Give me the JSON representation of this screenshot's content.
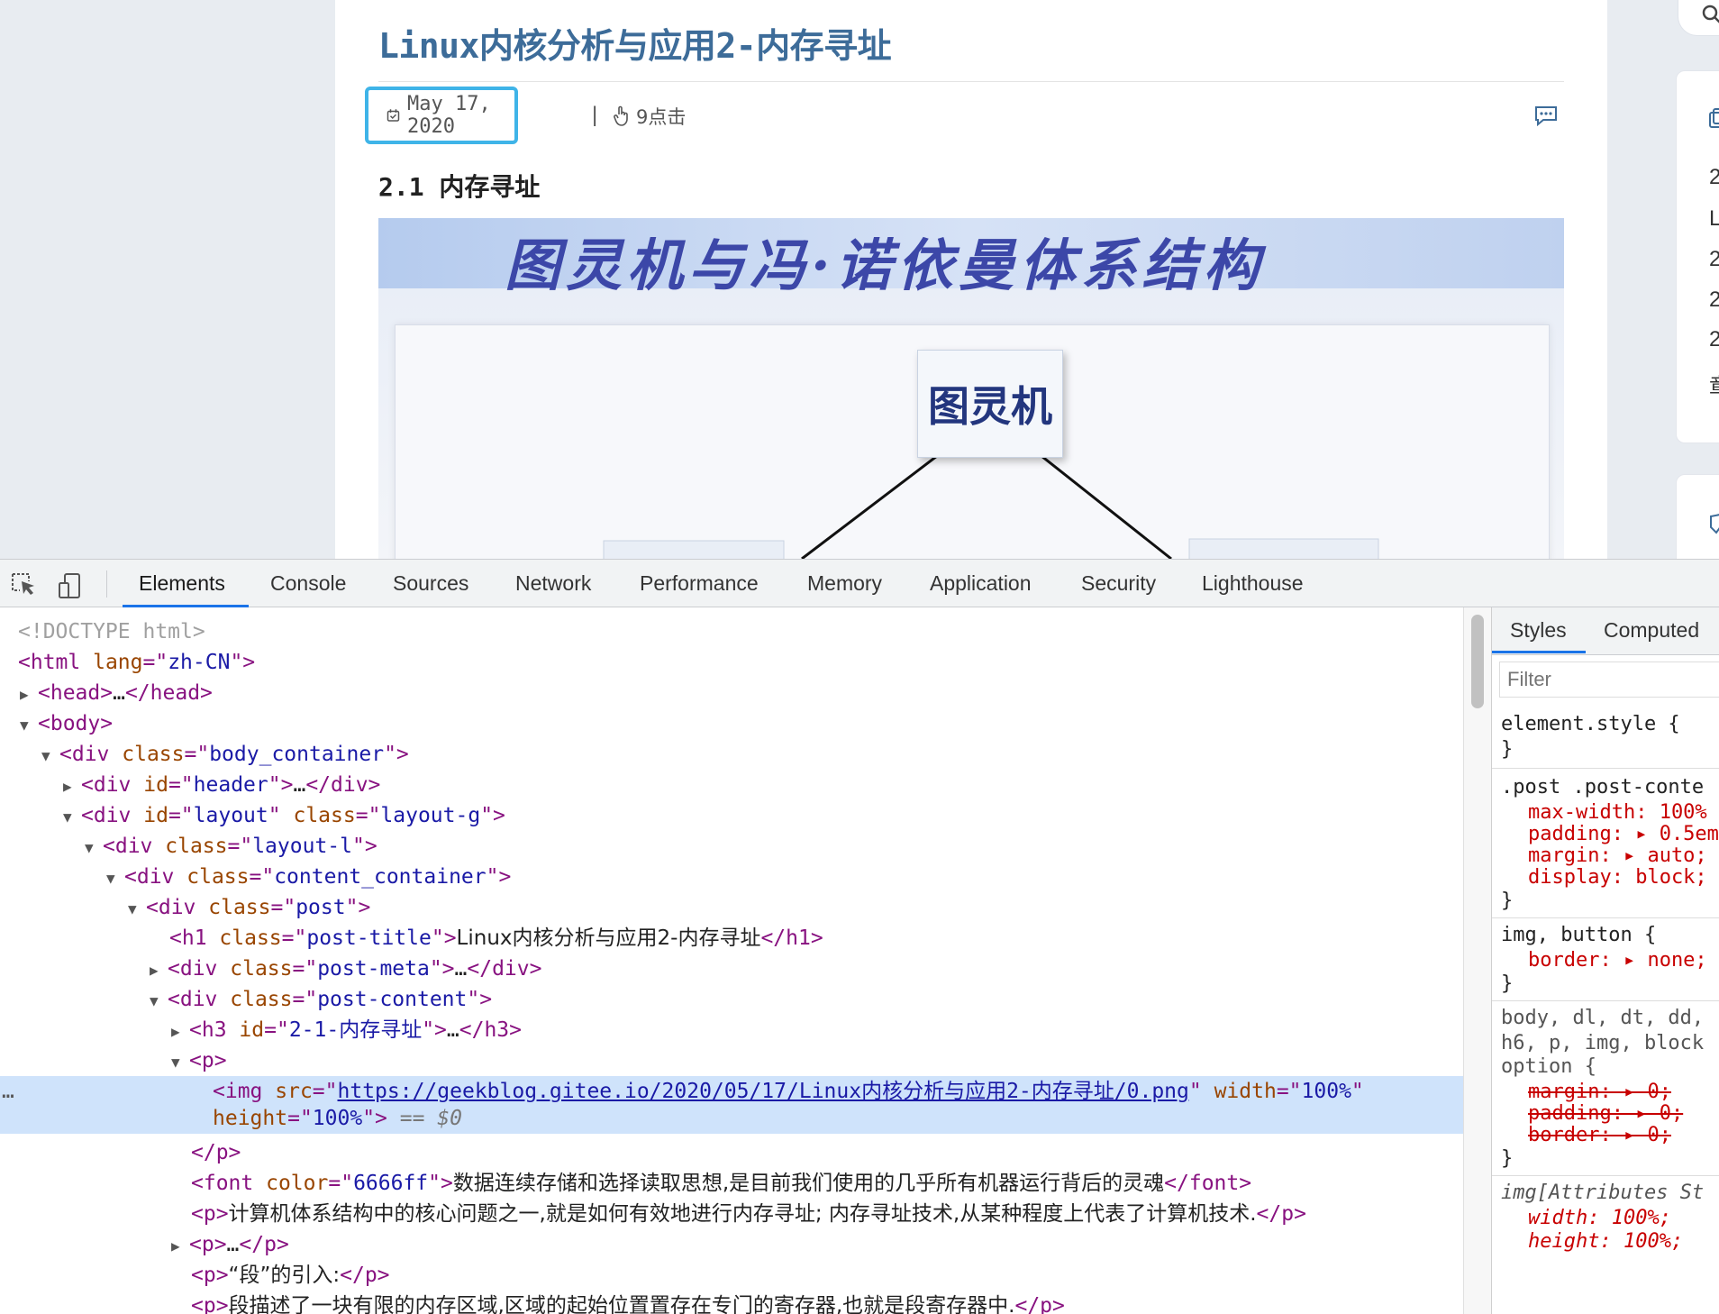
{
  "article": {
    "title": "Linux内核分析与应用2-内存寻址",
    "date": "May 17, 2020",
    "separator": "|",
    "clicks": "9点击",
    "section_title": "2.1 内存寻址",
    "figure_banner": "图灵机与冯·诺依曼体系结构",
    "figure_node": "图灵机"
  },
  "sidebar": {
    "lines": [
      "2",
      "L",
      "2",
      "2",
      "2",
      "章"
    ]
  },
  "devtools": {
    "tabs": [
      "Elements",
      "Console",
      "Sources",
      "Network",
      "Performance",
      "Memory",
      "Application",
      "Security",
      "Lighthouse"
    ],
    "active_tab": "Elements",
    "dom": {
      "doctype": "<!DOCTYPE html>",
      "html_lang": "zh-CN",
      "body_container_class": "body_container",
      "header_id": "header",
      "layout_id": "layout",
      "layout_class": "layout-g",
      "layout_l_class": "layout-l",
      "content_container_class": "content_container",
      "post_class": "post",
      "post_title_class": "post-title",
      "post_title_text": "Linux内核分析与应用2-内存寻址",
      "post_meta_class": "post-meta",
      "post_content_class": "post-content",
      "h3_id": "2-1-内存寻址",
      "img_src": "https://geekblog.gitee.io/2020/05/17/Linux内核分析与应用2-内存寻址/0.png",
      "img_width": "100%",
      "img_height": "100%",
      "selected_marker": "== $0",
      "font_color": "6666ff",
      "font_text": "数据连续存储和选择读取思想,是目前我们使用的几乎所有机器运行背后的灵魂",
      "p1_text": "计算机体系结构中的核心问题之一,就是如何有效地进行内存寻址; 内存寻址技术,从某种程度上代表了计算机技术.",
      "p3_text": "“段”的引入:",
      "p4_text": "段描述了一块有限的内存区域,区域的起始位置置存在专门的寄存器,也就是段寄存器中."
    },
    "styles": {
      "tabs": [
        "Styles",
        "Computed"
      ],
      "filter_placeholder": "Filter",
      "rules": {
        "element_style": "element.style {",
        "close": "}",
        "post_selector": ".post .post-conte",
        "max_width": "max-width: 100%",
        "padding": "padding: ▸ 0.5em",
        "margin": "margin: ▸ auto;",
        "display": "display: block;",
        "img_button": "img, button {",
        "border": "border: ▸ none;",
        "body_selector_1": "body, dl, dt, dd,",
        "body_selector_2": "h6, p, img, block",
        "body_selector_3": "option {",
        "margin0": "margin: ▸ 0;",
        "padding0": "padding: ▸ 0;",
        "border0": "border: ▸ 0;",
        "img_attr": "img[Attributes St",
        "width_attr": "width: 100%;",
        "height_attr": "height: 100%;"
      }
    }
  }
}
